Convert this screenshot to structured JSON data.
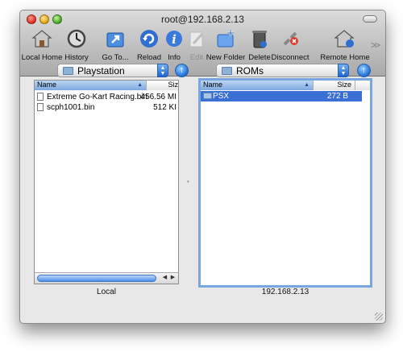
{
  "window": {
    "title": "root@192.168.2.13"
  },
  "toolbar": {
    "items": [
      {
        "label": "Local Home",
        "icon": "home-icon"
      },
      {
        "label": "History",
        "icon": "clock-icon"
      },
      {
        "label": "Go To...",
        "icon": "goto-folder-icon"
      },
      {
        "label": "Reload",
        "icon": "reload-icon"
      },
      {
        "label": "Info",
        "icon": "info-icon"
      },
      {
        "label": "Edit",
        "icon": "edit-icon",
        "disabled": true
      },
      {
        "label": "New Folder",
        "icon": "new-folder-icon"
      },
      {
        "label": "Delete",
        "icon": "trash-icon"
      },
      {
        "label": "Disconnect",
        "icon": "disconnect-icon"
      },
      {
        "label": "Remote Home",
        "icon": "remote-home-icon"
      }
    ]
  },
  "local": {
    "folder": "Playstation",
    "columns": {
      "name": "Name",
      "size": "Siz"
    },
    "files": [
      {
        "name": "Extreme Go-Kart Racing.bin",
        "size": "456.56 MI"
      },
      {
        "name": "scph1001.bin",
        "size": "512 KI"
      }
    ],
    "footer": "Local"
  },
  "remote": {
    "folder": "ROMs",
    "columns": {
      "name": "Name",
      "size": "Size"
    },
    "files": [
      {
        "name": "PSX",
        "size": "272 B",
        "selected": true
      }
    ],
    "footer": "192.168.2.13"
  },
  "colors": {
    "accent": "#3a6fd6",
    "focus": "#7aa6e0"
  }
}
